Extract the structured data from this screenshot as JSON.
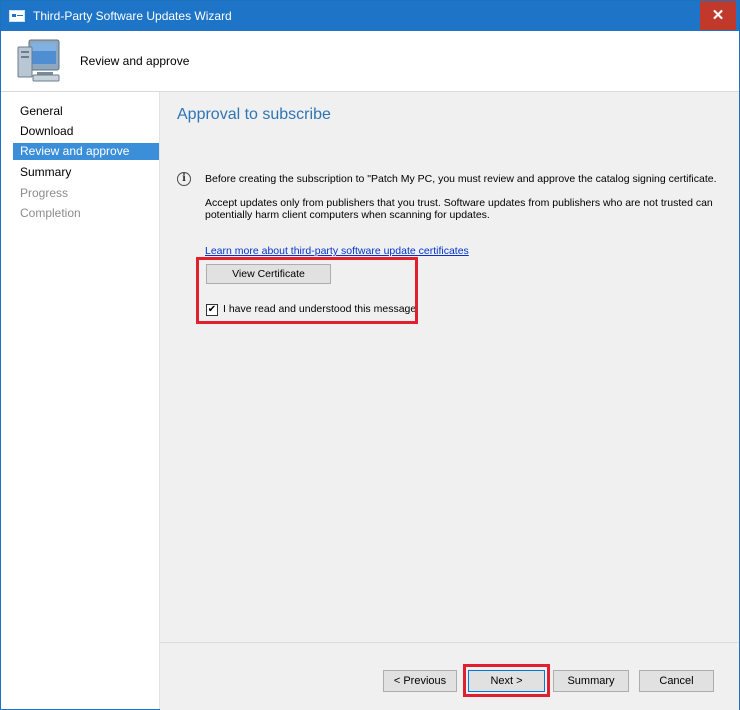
{
  "window": {
    "title": "Third-Party Software Updates Wizard",
    "close_symbol": "✕"
  },
  "header": {
    "title": "Review and approve",
    "icon": "computer-monitor-icon"
  },
  "sidebar": {
    "items": [
      {
        "label": "General",
        "state": "normal"
      },
      {
        "label": "Download",
        "state": "normal"
      },
      {
        "label": "Review and approve",
        "state": "selected"
      },
      {
        "label": "Summary",
        "state": "normal"
      },
      {
        "label": "Progress",
        "state": "disabled"
      },
      {
        "label": "Completion",
        "state": "disabled"
      }
    ]
  },
  "main": {
    "page_title": "Approval to subscribe",
    "info_icon": "info-icon",
    "message_line1": "Before creating the subscription to \"Patch My PC, you must review and approve the catalog signing certificate.",
    "message_line2": "Accept updates only from publishers that you trust. Software updates from publishers who are not trusted can",
    "message_line3": "potentially harm client computers when scanning for updates.",
    "cert_link": "Learn more about third-party software update certificates",
    "view_cert_label": "View Certificate",
    "checkbox_label": "I have read and understood this message",
    "checkbox_checked": true,
    "checkmark": "✔"
  },
  "footer": {
    "previous_label": "< Previous",
    "next_label": "Next >",
    "summary_label": "Summary",
    "cancel_label": "Cancel"
  },
  "colors": {
    "titlebar": "#1e74c6",
    "close_button": "#c0392b",
    "selected_nav": "#3b8fd9",
    "page_title": "#2e75b6",
    "highlight": "#e0202e",
    "link": "#0033cc"
  }
}
